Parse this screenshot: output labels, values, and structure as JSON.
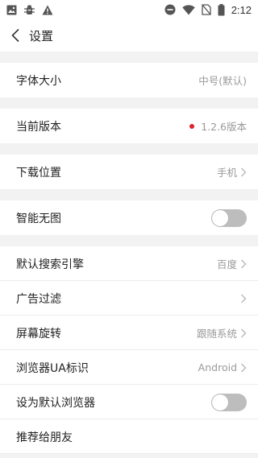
{
  "status_bar": {
    "time": "2:12",
    "icons": [
      "image-icon",
      "bug-icon",
      "warning-icon",
      "do-not-disturb-icon",
      "wifi-icon",
      "sim-off-icon",
      "battery-icon"
    ]
  },
  "header": {
    "back_icon": "chevron-left-icon",
    "title": "设置"
  },
  "settings": {
    "font_size": {
      "label": "字体大小",
      "value": "中号(默认)"
    },
    "version": {
      "label": "当前版本",
      "value": "1.2.6版本",
      "dot_color": "#e0202c"
    },
    "download_location": {
      "label": "下载位置",
      "value": "手机"
    },
    "smart_no_image": {
      "label": "智能无图",
      "enabled": false
    },
    "search_engine": {
      "label": "默认搜索引擎",
      "value": "百度"
    },
    "ad_filter": {
      "label": "广告过滤",
      "value": ""
    },
    "screen_rotation": {
      "label": "屏幕旋转",
      "value": "跟随系统"
    },
    "browser_ua": {
      "label": "浏览器UA标识",
      "value": "Android"
    },
    "set_default_browser": {
      "label": "设为默认浏览器",
      "enabled": false
    },
    "recommend_friends": {
      "label": "推荐给朋友"
    }
  },
  "colors": {
    "toggle_off": "#bdbdbd",
    "page_bg": "#f2f2f2",
    "row_bg": "#ffffff"
  }
}
